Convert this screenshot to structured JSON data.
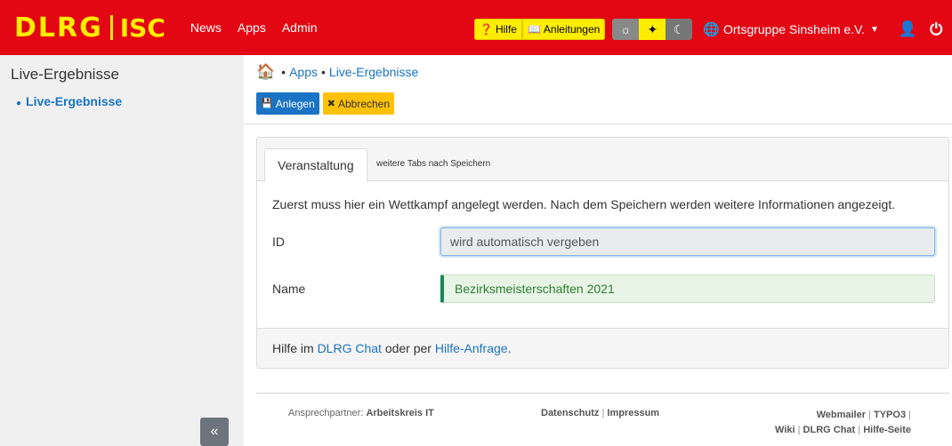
{
  "header": {
    "brand_dlrg": "DLRG",
    "brand_isc": "ISC",
    "nav": [
      "News",
      "Apps",
      "Admin"
    ],
    "help_label": "Hilfe",
    "guides_label": "Anleitungen",
    "org_label": "Ortsgruppe Sinsheim e.V."
  },
  "sidebar": {
    "title": "Live-Ergebnisse",
    "items": [
      {
        "label": "Live-Ergebnisse"
      }
    ],
    "collapse_label": "«"
  },
  "breadcrumb": {
    "separator": "•",
    "items": [
      "Apps",
      "Live-Ergebnisse"
    ]
  },
  "toolbar": {
    "save_label": "Anlegen",
    "cancel_label": "Abbrechen"
  },
  "tabs": {
    "active": "Veranstaltung",
    "inactive": "weitere Tabs nach Speichern"
  },
  "form": {
    "intro": "Zuerst muss hier ein Wettkampf angelegt werden. Nach dem Speichern werden weitere Informationen angezeigt.",
    "id_label": "ID",
    "id_value": "wird automatisch vergeben",
    "name_label": "Name",
    "name_value": "Bezirksmeisterschaften 2021"
  },
  "card_footer": {
    "prefix": "Hilfe im ",
    "chat_link": "DLRG Chat",
    "middle": " oder per ",
    "request_link": "Hilfe-Anfrage",
    "suffix": "."
  },
  "footer": {
    "contact_prefix": "Ansprechpartner: ",
    "contact_name": "Arbeitskreis IT",
    "privacy": "Datenschutz",
    "imprint": "Impressum",
    "webmailer": "Webmailer",
    "typo3": "TYPO3",
    "wiki": "Wiki",
    "dlrg_chat": "DLRG Chat",
    "help_page": "Hilfe-Seite",
    "pipe": "|"
  },
  "colors": {
    "brand_red": "#e30613",
    "brand_yellow": "#ffed00",
    "primary": "#1a73c4",
    "warning": "#ffc107",
    "success": "#198754"
  }
}
